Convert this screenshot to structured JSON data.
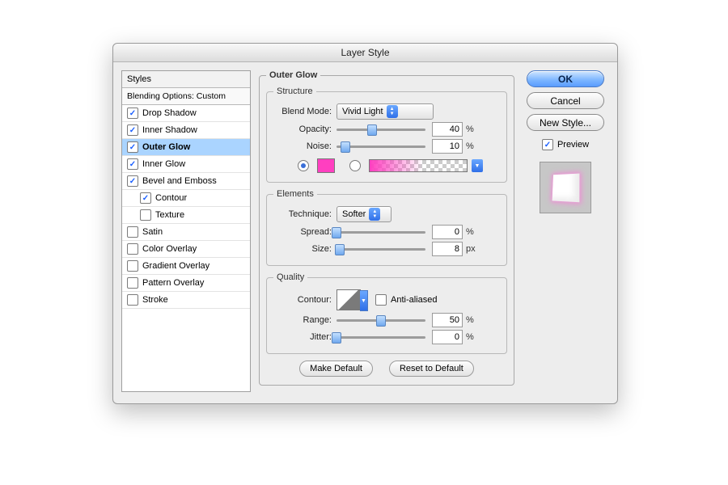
{
  "title": "Layer Style",
  "sidebar": {
    "header": "Styles",
    "subheader": "Blending Options: Custom",
    "items": [
      {
        "label": "Drop Shadow",
        "checked": true,
        "indent": false
      },
      {
        "label": "Inner Shadow",
        "checked": true,
        "indent": false
      },
      {
        "label": "Outer Glow",
        "checked": true,
        "indent": false,
        "selected": true
      },
      {
        "label": "Inner Glow",
        "checked": true,
        "indent": false
      },
      {
        "label": "Bevel and Emboss",
        "checked": true,
        "indent": false
      },
      {
        "label": "Contour",
        "checked": true,
        "indent": true
      },
      {
        "label": "Texture",
        "checked": false,
        "indent": true
      },
      {
        "label": "Satin",
        "checked": false,
        "indent": false
      },
      {
        "label": "Color Overlay",
        "checked": false,
        "indent": false
      },
      {
        "label": "Gradient Overlay",
        "checked": false,
        "indent": false
      },
      {
        "label": "Pattern Overlay",
        "checked": false,
        "indent": false
      },
      {
        "label": "Stroke",
        "checked": false,
        "indent": false
      }
    ]
  },
  "panel": {
    "title": "Outer Glow",
    "structure": {
      "legend": "Structure",
      "blend_mode_label": "Blend Mode:",
      "blend_mode_value": "Vivid Light",
      "opacity_label": "Opacity:",
      "opacity_value": "40",
      "opacity_pct": 40,
      "noise_label": "Noise:",
      "noise_value": "10",
      "noise_pct": 10,
      "solid_selected": true,
      "gradient_selected": false,
      "solid_color": "#ff3fc0",
      "percent": "%"
    },
    "elements": {
      "legend": "Elements",
      "technique_label": "Technique:",
      "technique_value": "Softer",
      "spread_label": "Spread:",
      "spread_value": "0",
      "spread_pct": 0,
      "size_label": "Size:",
      "size_value": "8",
      "size_pct": 4,
      "px": "px",
      "percent": "%"
    },
    "quality": {
      "legend": "Quality",
      "contour_label": "Contour:",
      "antialias_label": "Anti-aliased",
      "antialias_checked": false,
      "range_label": "Range:",
      "range_value": "50",
      "range_pct": 50,
      "jitter_label": "Jitter:",
      "jitter_value": "0",
      "jitter_pct": 0,
      "percent": "%"
    },
    "make_default": "Make Default",
    "reset_default": "Reset to Default"
  },
  "right": {
    "ok": "OK",
    "cancel": "Cancel",
    "new_style": "New Style...",
    "preview_label": "Preview",
    "preview_checked": true
  }
}
